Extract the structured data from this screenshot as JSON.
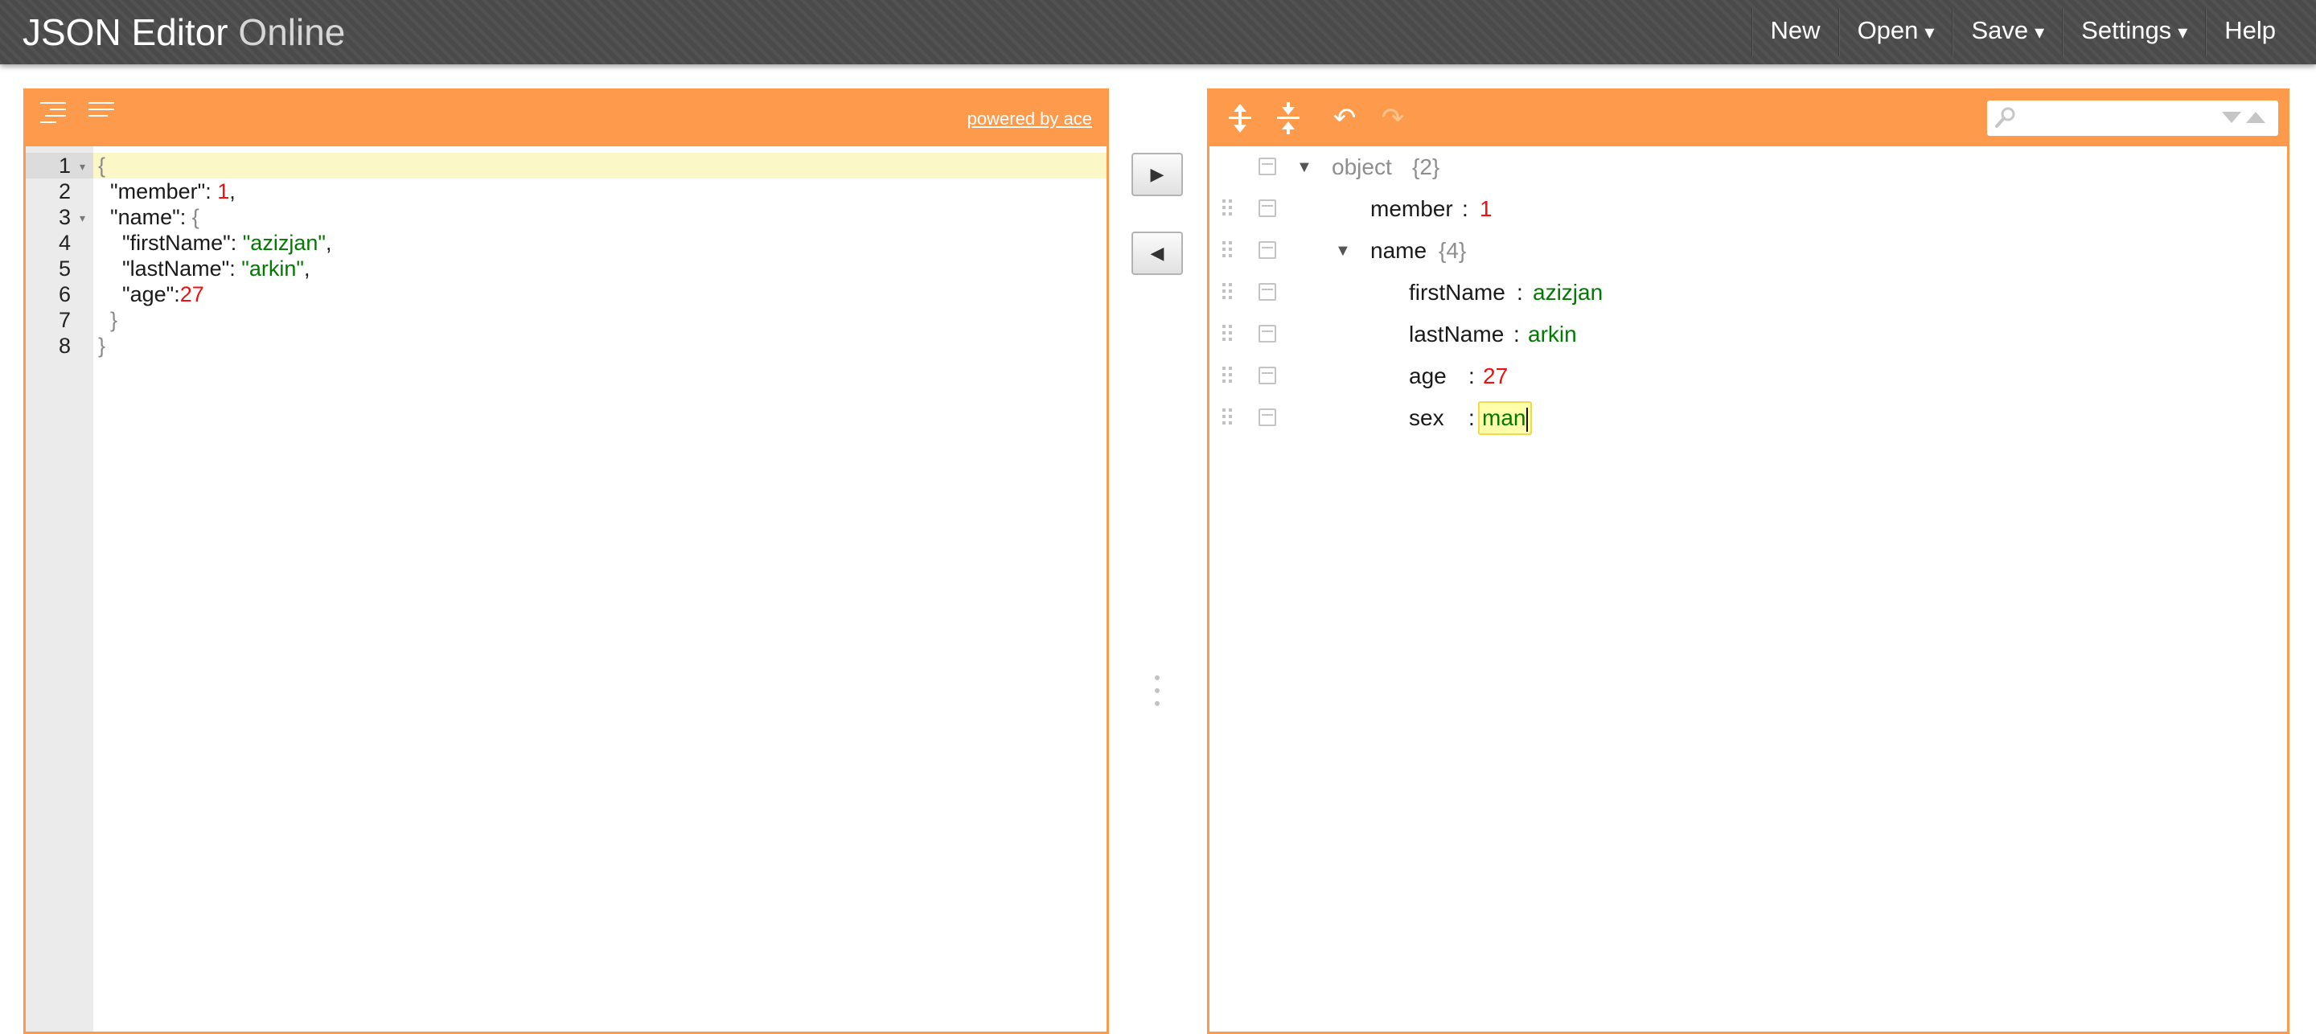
{
  "header": {
    "title_main": "JSON Editor",
    "title_light": "Online",
    "menu": {
      "new_label": "New",
      "open_label": "Open",
      "save_label": "Save",
      "settings_label": "Settings",
      "help_label": "Help",
      "dropdown_caret": "▾"
    }
  },
  "code_editor": {
    "toolbar": {
      "format_icon": "format-icon",
      "compact_icon": "compact-icon",
      "powered_by": "powered by ace"
    },
    "line_numbers": [
      "1",
      "2",
      "3",
      "4",
      "5",
      "6",
      "7",
      "8"
    ],
    "active_line": 1,
    "lines": [
      "{",
      "  \"member\": 1,",
      "  \"name\": {",
      "    \"firstName\": \"azizjan\",",
      "    \"lastName\": \"arkin\",",
      "    \"age\":27",
      "  }",
      "}"
    ]
  },
  "splitter": {
    "copy_right_icon": "▶",
    "copy_left_icon": "◀"
  },
  "tree_editor": {
    "toolbar": {
      "expand_all_icon": "expand-all-icon",
      "collapse_all_icon": "collapse-all-icon",
      "undo_icon": "↶",
      "redo_icon": "↷"
    },
    "search": {
      "value": "",
      "placeholder": ""
    },
    "nodes": [
      {
        "field": "object",
        "count": "{2}",
        "toggle": "▼"
      },
      {
        "field": "member",
        "separator": ":",
        "value": "1"
      },
      {
        "field": "name",
        "count": "{4}",
        "toggle": "▼"
      },
      {
        "field": "firstName",
        "separator": ":",
        "value": "azizjan"
      },
      {
        "field": "lastName",
        "separator": ":",
        "value": "arkin"
      },
      {
        "field": "age",
        "separator": ":",
        "value": "27"
      },
      {
        "field": "sex",
        "separator": ":",
        "value": "man"
      }
    ]
  },
  "colors": {
    "accent": "#fd9a4b",
    "header_bg": "#4a4a4a",
    "string": "#007b00",
    "number": "#ee1111",
    "active_line": "#fbf7c6"
  }
}
